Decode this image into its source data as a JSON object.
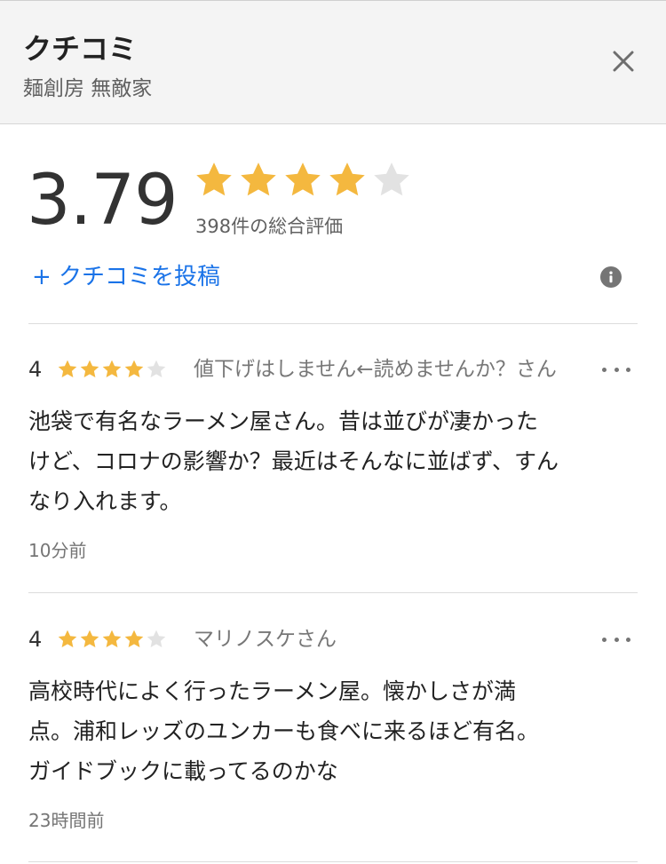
{
  "header": {
    "title": "クチコミ",
    "subtitle": "麺創房 無敵家"
  },
  "summary": {
    "rating": "3.79",
    "stars_filled": 4,
    "stars_total": 5,
    "total_text": "398件の総合評価",
    "post_label": "+ クチコミを投稿"
  },
  "reviews": [
    {
      "score": "4",
      "stars_filled": 4,
      "author": "値下げはしません←読めませんか？さん",
      "text_lines": [
        "池袋で有名なラーメン屋さん。昔は並びが凄かった",
        "けど、コロナの影響か？最近はそんなに並ばず、すん",
        "なり入れます。"
      ],
      "time": "10分前"
    },
    {
      "score": "4",
      "stars_filled": 4,
      "author": "マリノスケさん",
      "text_lines": [
        "高校時代によく行ったラーメン屋。懐かしさが満",
        "点。浦和レッズのユンカーも食べに来るほど有名。",
        "ガイドブックに載ってるのかな"
      ],
      "time": "23時間前"
    }
  ],
  "colors": {
    "star_filled": "#f4b83f",
    "star_empty": "#e2e2e2",
    "link": "#1a73e8",
    "header_bg": "#f4f4f4"
  },
  "icons": {
    "close": "close-icon",
    "info": "info-icon",
    "more": "more-horizontal-icon",
    "star": "star-icon"
  }
}
